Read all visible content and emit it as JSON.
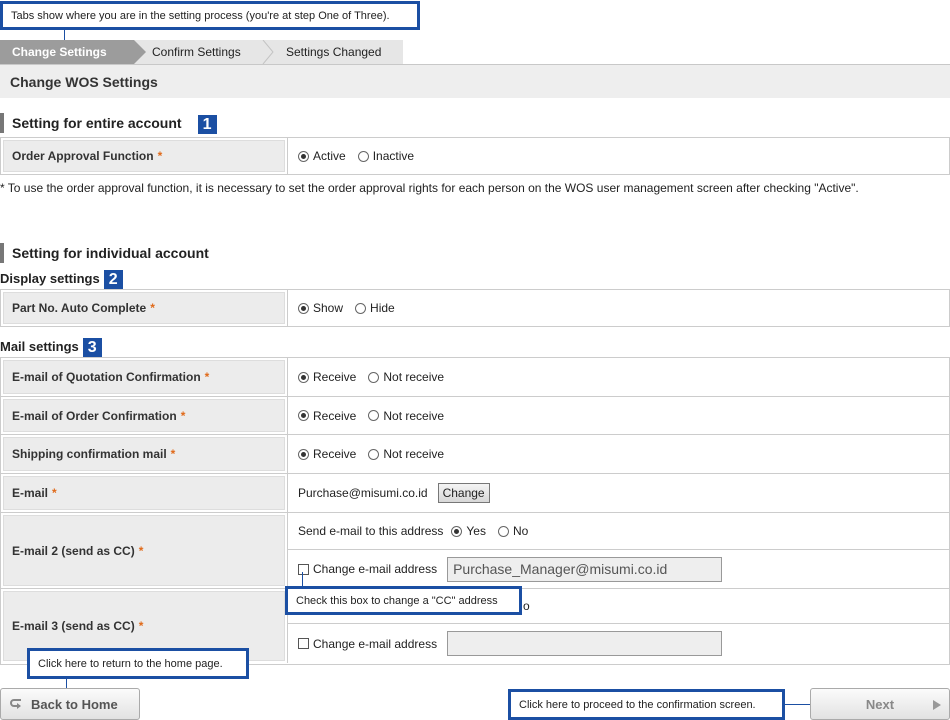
{
  "callouts": {
    "tabs": "Tabs show where you are in the setting process (you're at step One of Three).",
    "cc": "Check this box to change a \"CC\" address",
    "home": "Click here to return to the home page.",
    "next": "Click here to proceed to the confirmation screen."
  },
  "steps": [
    "Change Settings",
    "Confirm Settings",
    "Settings Changed"
  ],
  "page_title": "Change WOS Settings",
  "required_mark": "*",
  "section1": {
    "title": "Setting for entire account",
    "badge": "1",
    "rows": [
      {
        "label": "Order Approval Function",
        "options": [
          "Active",
          "Inactive"
        ],
        "selected": 0
      }
    ],
    "note": "* To use the order approval function, it is necessary to set the order approval rights for each person on the WOS user management screen after checking \"Active\"."
  },
  "section2": {
    "title": "Setting for individual account",
    "display": {
      "title": "Display settings",
      "badge": "2",
      "rows": [
        {
          "label": "Part No. Auto Complete",
          "options": [
            "Show",
            "Hide"
          ],
          "selected": 0
        }
      ]
    },
    "mail": {
      "title": "Mail settings",
      "badge": "3",
      "quotation": {
        "label": "E-mail of Quotation Confirmation",
        "options": [
          "Receive",
          "Not receive"
        ],
        "selected": 0
      },
      "order": {
        "label": "E-mail of Order Confirmation",
        "options": [
          "Receive",
          "Not receive"
        ],
        "selected": 0
      },
      "shipping": {
        "label": "Shipping confirmation mail",
        "options": [
          "Receive",
          "Not receive"
        ],
        "selected": 0
      },
      "email": {
        "label": "E-mail",
        "value": "Purchase@misumi.co.id",
        "button": "Change"
      },
      "email2": {
        "label": "E-mail 2 (send as CC)",
        "send_label": "Send e-mail to this address",
        "options": [
          "Yes",
          "No"
        ],
        "selected": 0,
        "change_label": "Change e-mail address",
        "value": "Purchase_Manager@misumi.co.id"
      },
      "email3": {
        "label": "E-mail 3 (send as CC)",
        "partial_option": "o",
        "change_label": "Change e-mail address",
        "value": ""
      }
    }
  },
  "buttons": {
    "back": "Back to Home",
    "next": "Next"
  },
  "colors": {
    "accent": "#1b4fa3",
    "required": "#e06a1a",
    "active_step": "#9c9c9c"
  }
}
